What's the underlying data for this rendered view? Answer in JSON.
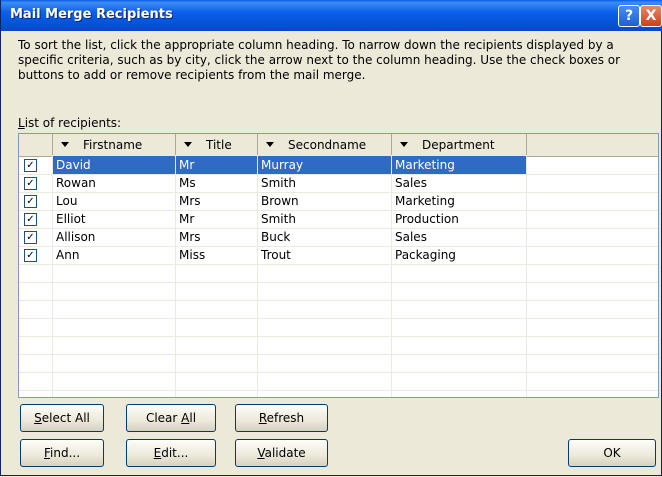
{
  "window": {
    "title": "Mail Merge Recipients",
    "help_glyph": "?",
    "close_glyph": "X"
  },
  "description": "To sort the list, click the appropriate column heading.  To narrow down the recipients displayed by a specific criteria, such as by city, click the arrow next to the column heading.  Use the check boxes or buttons to add or remove recipients from the mail merge.",
  "list_label_prefix": "L",
  "list_label_rest": "ist of recipients:",
  "columns": [
    "Firstname",
    "Title",
    "Secondname",
    "Department"
  ],
  "rows": [
    {
      "checked": true,
      "firstname": "David",
      "title": "Mr",
      "secondname": "Murray",
      "department": "Marketing"
    },
    {
      "checked": true,
      "firstname": "Rowan",
      "title": "Ms",
      "secondname": "Smith",
      "department": "Sales"
    },
    {
      "checked": true,
      "firstname": "Lou",
      "title": "Mrs",
      "secondname": "Brown",
      "department": "Marketing"
    },
    {
      "checked": true,
      "firstname": "Elliot",
      "title": "Mr",
      "secondname": "Smith",
      "department": "Production"
    },
    {
      "checked": true,
      "firstname": "Allison",
      "title": "Mrs",
      "secondname": "Buck",
      "department": "Sales"
    },
    {
      "checked": true,
      "firstname": "Ann",
      "title": "Miss",
      "secondname": "Trout",
      "department": "Packaging"
    }
  ],
  "check_glyph": "✓",
  "buttons": {
    "select_all": {
      "u": "S",
      "rest": "elect All"
    },
    "clear_all": {
      "pre": "Clear ",
      "u": "A",
      "rest": "ll"
    },
    "refresh": {
      "u": "R",
      "rest": "efresh"
    },
    "find": {
      "u": "F",
      "rest": "ind..."
    },
    "edit": {
      "u": "E",
      "rest": "dit..."
    },
    "validate": {
      "u": "V",
      "rest": "alidate"
    },
    "ok": "OK"
  },
  "colors": {
    "selection": "#316ac5",
    "titlebar": "#0b5fe9"
  }
}
